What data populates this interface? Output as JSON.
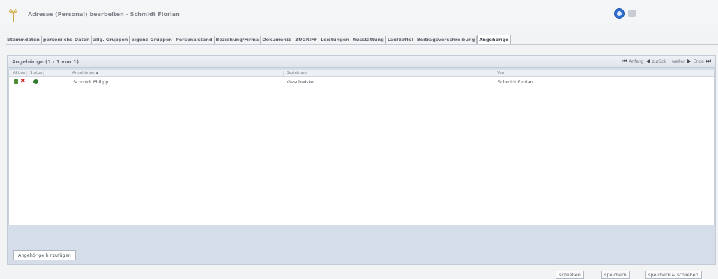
{
  "window": {
    "title": "Adresse (Personal) bearbeiten - Schmidt Florian",
    "icons": [
      "palm-icon",
      "help-icon",
      "print-icon"
    ]
  },
  "tabs": [
    {
      "label": "Stammdaten",
      "active": false
    },
    {
      "label": "persönliche Daten",
      "active": false
    },
    {
      "label": "allg. Gruppen",
      "active": false
    },
    {
      "label": "eigene Gruppen",
      "active": false
    },
    {
      "label": "Personalstand",
      "active": false
    },
    {
      "label": "Beziehung/Firma",
      "active": false
    },
    {
      "label": "Dokumente",
      "active": false
    },
    {
      "label": "ZUGRIFF",
      "active": false
    },
    {
      "label": "Leistungen",
      "active": false
    },
    {
      "label": "Ausstattung",
      "active": false
    },
    {
      "label": "Laufzettel",
      "active": false
    },
    {
      "label": "Beitragsverschreibung",
      "active": false
    },
    {
      "label": "Angehörige",
      "active": true
    }
  ],
  "panel": {
    "title": "Angehörige (1 - 1 von 1)",
    "pager": {
      "first": "Anfang",
      "prev": "zurück",
      "separator": "|",
      "next": "weiter",
      "last": "Ende"
    },
    "columns": [
      "Aktion",
      "Status",
      "Angehörige ▲",
      "Beziehung",
      "Von"
    ],
    "rows": [
      {
        "name": "Schmidt Philipp",
        "relation": "Geschwister",
        "from": "Schmidt Florian",
        "status_color": "#2f7a2f"
      }
    ],
    "add_button": "Angehörige hinzufügen"
  },
  "footer": {
    "close": "schließen",
    "save": "speichern",
    "save_close": "speichern & schließen"
  }
}
